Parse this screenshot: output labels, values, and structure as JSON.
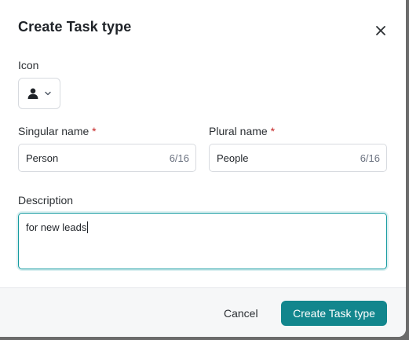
{
  "dialog": {
    "title": "Create Task type",
    "close_icon": "close-icon"
  },
  "icon_field": {
    "label": "Icon",
    "selected_icon": "person-icon",
    "dropdown_icon": "chevron-down-icon"
  },
  "singular": {
    "label": "Singular name",
    "required_mark": "*",
    "value": "Person",
    "counter": "6/16"
  },
  "plural": {
    "label": "Plural name",
    "required_mark": "*",
    "value": "People",
    "counter": "6/16"
  },
  "description": {
    "label": "Description",
    "value": "for new leads"
  },
  "footer": {
    "cancel_label": "Cancel",
    "create_label": "Create Task type"
  },
  "colors": {
    "primary": "#12868d",
    "focus_border": "#149aa0",
    "required": "#c62828"
  }
}
